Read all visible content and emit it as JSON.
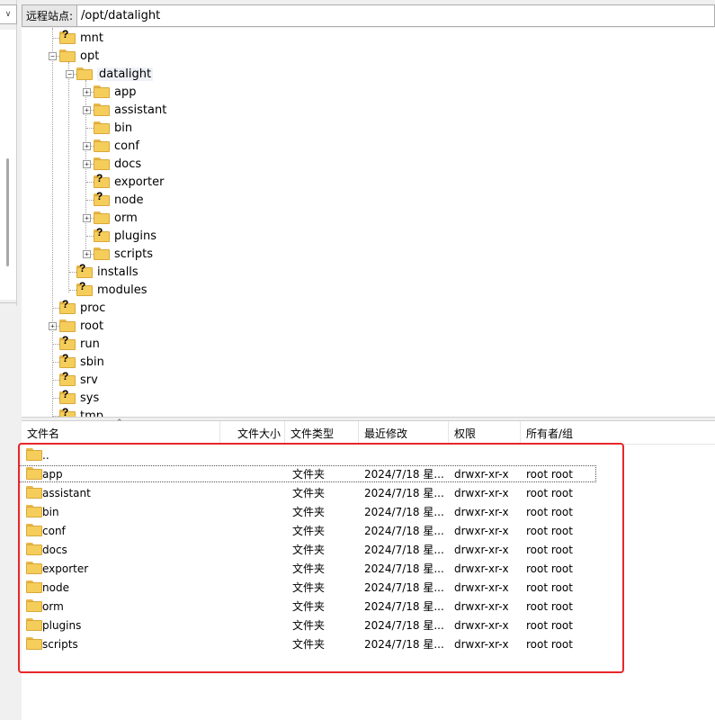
{
  "site_bar": {
    "label": "远程站点:",
    "path": "/opt/datalight"
  },
  "tree": {
    "items": [
      {
        "label": "mnt",
        "icon": "folder-unknown-icon"
      },
      {
        "label": "opt",
        "icon": "folder-icon",
        "expanded": true
      },
      {
        "label": "datalight",
        "icon": "folder-open-icon",
        "expanded": true,
        "selected": true
      },
      {
        "label": "app",
        "icon": "folder-icon"
      },
      {
        "label": "assistant",
        "icon": "folder-icon"
      },
      {
        "label": "bin",
        "icon": "folder-icon"
      },
      {
        "label": "conf",
        "icon": "folder-icon"
      },
      {
        "label": "docs",
        "icon": "folder-icon"
      },
      {
        "label": "exporter",
        "icon": "folder-unknown-icon"
      },
      {
        "label": "node",
        "icon": "folder-unknown-icon"
      },
      {
        "label": "orm",
        "icon": "folder-icon"
      },
      {
        "label": "plugins",
        "icon": "folder-unknown-icon"
      },
      {
        "label": "scripts",
        "icon": "folder-icon"
      },
      {
        "label": "installs",
        "icon": "folder-unknown-icon"
      },
      {
        "label": "modules",
        "icon": "folder-unknown-icon"
      },
      {
        "label": "proc",
        "icon": "folder-unknown-icon"
      },
      {
        "label": "root",
        "icon": "folder-icon"
      },
      {
        "label": "run",
        "icon": "folder-unknown-icon"
      },
      {
        "label": "sbin",
        "icon": "folder-unknown-icon"
      },
      {
        "label": "srv",
        "icon": "folder-unknown-icon"
      },
      {
        "label": "sys",
        "icon": "folder-unknown-icon"
      },
      {
        "label": "tmp",
        "icon": "folder-unknown-icon"
      }
    ]
  },
  "file_list": {
    "columns": [
      "文件名",
      "文件大小",
      "文件类型",
      "最近修改",
      "权限",
      "所有者/组"
    ],
    "rows": [
      {
        "name": "..",
        "size": "",
        "type": "",
        "modified": "",
        "perms": "",
        "owner": ""
      },
      {
        "name": "app",
        "size": "",
        "type": "文件夹",
        "modified": "2024/7/18 星...",
        "perms": "drwxr-xr-x",
        "owner": "root root"
      },
      {
        "name": "assistant",
        "size": "",
        "type": "文件夹",
        "modified": "2024/7/18 星...",
        "perms": "drwxr-xr-x",
        "owner": "root root"
      },
      {
        "name": "bin",
        "size": "",
        "type": "文件夹",
        "modified": "2024/7/18 星...",
        "perms": "drwxr-xr-x",
        "owner": "root root"
      },
      {
        "name": "conf",
        "size": "",
        "type": "文件夹",
        "modified": "2024/7/18 星...",
        "perms": "drwxr-xr-x",
        "owner": "root root"
      },
      {
        "name": "docs",
        "size": "",
        "type": "文件夹",
        "modified": "2024/7/18 星...",
        "perms": "drwxr-xr-x",
        "owner": "root root"
      },
      {
        "name": "exporter",
        "size": "",
        "type": "文件夹",
        "modified": "2024/7/18 星...",
        "perms": "drwxr-xr-x",
        "owner": "root root"
      },
      {
        "name": "node",
        "size": "",
        "type": "文件夹",
        "modified": "2024/7/18 星...",
        "perms": "drwxr-xr-x",
        "owner": "root root"
      },
      {
        "name": "orm",
        "size": "",
        "type": "文件夹",
        "modified": "2024/7/18 星...",
        "perms": "drwxr-xr-x",
        "owner": "root root"
      },
      {
        "name": "plugins",
        "size": "",
        "type": "文件夹",
        "modified": "2024/7/18 星...",
        "perms": "drwxr-xr-x",
        "owner": "root root"
      },
      {
        "name": "scripts",
        "size": "",
        "type": "文件夹",
        "modified": "2024/7/18 星...",
        "perms": "drwxr-xr-x",
        "owner": "root root"
      }
    ]
  },
  "colors": {
    "folder": "#f5cd5a",
    "highlight_box": "#e8262a"
  }
}
